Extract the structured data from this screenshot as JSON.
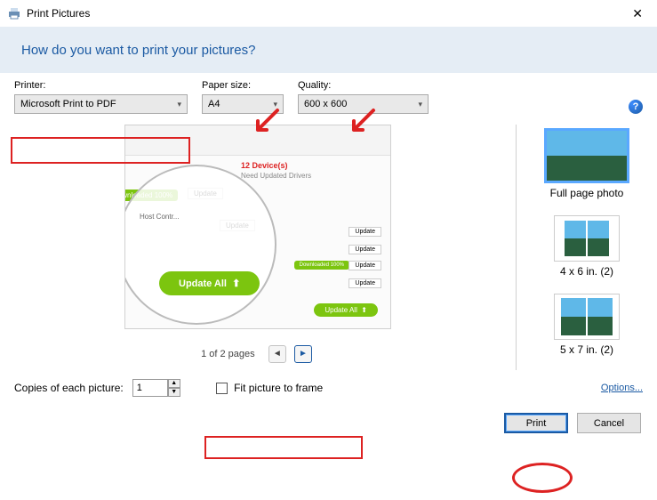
{
  "titlebar": {
    "title": "Print Pictures"
  },
  "header": {
    "question": "How do you want to print your pictures?"
  },
  "labels": {
    "printer": "Printer:",
    "paper": "Paper size:",
    "quality": "Quality:"
  },
  "selects": {
    "printer": "Microsoft Print to PDF",
    "paper": "A4",
    "quality": "600 x 600"
  },
  "pager": {
    "text": "1 of 2 pages"
  },
  "layouts": {
    "full": "Full page photo",
    "l4x6": "4 x 6 in. (2)",
    "l5x7": "5 x 7 in. (2)"
  },
  "bottom": {
    "copies_label": "Copies of each picture:",
    "copies_value": "1",
    "fit_label": "Fit picture to frame",
    "options": "Options..."
  },
  "buttons": {
    "print": "Print",
    "cancel": "Cancel"
  },
  "preview": {
    "alert_title": "12 Device(s)",
    "alert_sub": "Need Updated Drivers",
    "downloaded": "Downloaded 100%",
    "update": "Update",
    "update_all": "Update All",
    "host": "Host Contr..."
  }
}
